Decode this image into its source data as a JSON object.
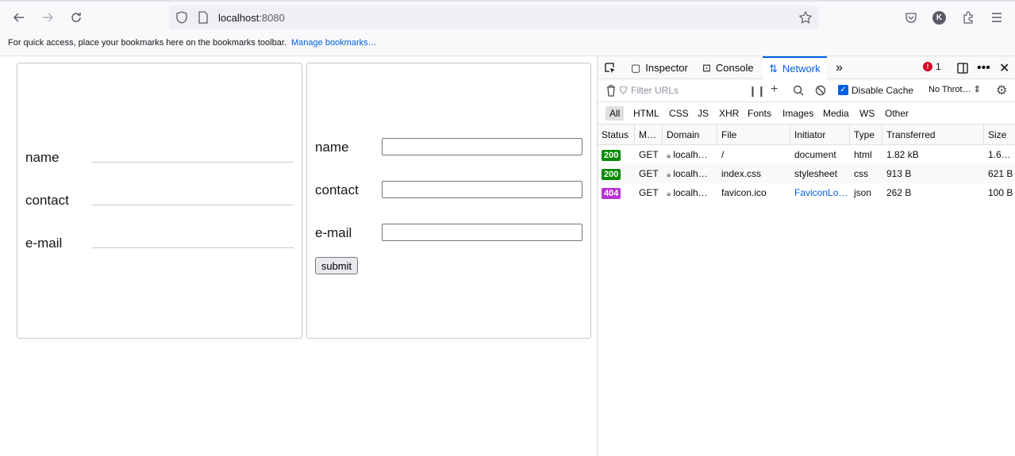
{
  "browser": {
    "url_host": "localhost",
    "url_port": ":8080",
    "avatar_letter": "K"
  },
  "bookmarks_bar": {
    "message": "For quick access, place your bookmarks here on the bookmarks toolbar.",
    "manage_link": "Manage bookmarks…"
  },
  "left_form": {
    "fields": [
      {
        "label": "name"
      },
      {
        "label": "contact"
      },
      {
        "label": "e-mail"
      }
    ]
  },
  "right_form": {
    "fields": [
      {
        "label": "name",
        "value": ""
      },
      {
        "label": "contact",
        "value": ""
      },
      {
        "label": "e-mail",
        "value": ""
      }
    ],
    "submit_label": "submit"
  },
  "devtools": {
    "tabs": [
      {
        "label": "Inspector",
        "icon": "inspector-icon"
      },
      {
        "label": "Console",
        "icon": "console-icon"
      },
      {
        "label": "Network",
        "icon": "network-icon",
        "active": true
      }
    ],
    "error_count": "1",
    "filter_placeholder": "Filter URLs",
    "disable_cache_label": "Disable Cache",
    "disable_cache_checked": true,
    "throttling": "No Throt…",
    "type_filters": [
      "All",
      "HTML",
      "CSS",
      "JS",
      "XHR",
      "Fonts",
      "Images",
      "Media",
      "WS",
      "Other"
    ],
    "active_type": "All",
    "columns": [
      "Status",
      "M…",
      "Domain",
      "File",
      "Initiator",
      "Type",
      "Transferred",
      "Size"
    ],
    "requests": [
      {
        "status": "200",
        "method": "GET",
        "domain": "localh…",
        "file": "/",
        "initiator": "document",
        "type": "html",
        "transferred": "1.82 kB",
        "size": "1.6…",
        "status_color": "#058b00"
      },
      {
        "status": "200",
        "method": "GET",
        "domain": "localh…",
        "file": "index.css",
        "initiator": "stylesheet",
        "type": "css",
        "transferred": "913 B",
        "size": "621 B",
        "status_color": "#058b00"
      },
      {
        "status": "404",
        "method": "GET",
        "domain": "localh…",
        "file": "favicon.ico",
        "initiator": "FaviconLo…",
        "type": "json",
        "transferred": "262 B",
        "size": "100 B",
        "status_color": "#b833d4"
      }
    ]
  },
  "colors": {
    "accent": "#0060df",
    "link": "#0061e0",
    "status_ok": "#058b00",
    "status_not_found": "#b833d4"
  }
}
